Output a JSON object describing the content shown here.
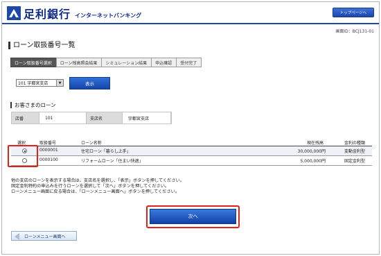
{
  "header": {
    "bank_name": "足利銀行",
    "service_name": "インターネットバンキング",
    "top_page_label": "トップページへ"
  },
  "screen_id": "画面ID：BCJ131-01",
  "page_title": "ローン取扱番号一覧",
  "steps": [
    "ローン取扱番号選択",
    "ローン残高照会結果",
    "シミュレーション結果",
    "申込確認",
    "受付完了"
  ],
  "branch_select": {
    "value": "101 宇都宮支店"
  },
  "show_button": "表示",
  "section_title": "お客さまのローン",
  "branch_info": {
    "store_label": "店番",
    "store_value": "101",
    "branch_label": "支店名",
    "branch_value": "宇都宮支店"
  },
  "loan_table": {
    "headers": [
      "選択",
      "取扱番号",
      "ローン名称",
      "現在残高",
      "金利の種類"
    ],
    "rows": [
      {
        "selected": true,
        "number": "0000001",
        "name": "住宅ローン「暮らし上手」",
        "balance": "30,000,000円",
        "rate_type": "変動金利型"
      },
      {
        "selected": false,
        "number": "0000100",
        "name": "リフォームローン「住まい快適」",
        "balance": "5,000,000円",
        "rate_type": "固定金利型"
      }
    ]
  },
  "notes": [
    "他の支店のローンを表示する場合は、支店名を選択し、「表示」ボタンを押してください。",
    "固定金利特約の申込みを行うローンを選択して「次へ」ボタンを押してください。",
    "ローンメニュー画面に戻る場合は、「ローンメニュー画面へ」ボタンを押してください。"
  ],
  "next_button": "次へ",
  "back_button": "ローンメニュー画面へ",
  "colors": {
    "brand_blue": "#1d48a8",
    "highlight_red": "#e0201b"
  }
}
